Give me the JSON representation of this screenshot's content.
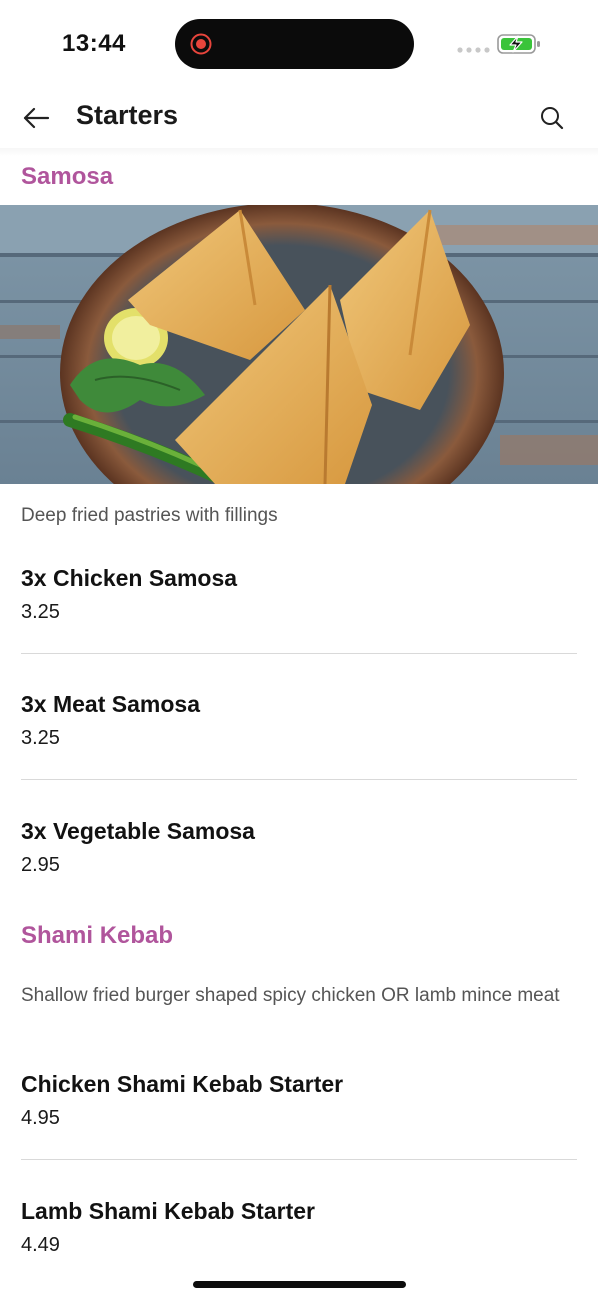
{
  "status_bar": {
    "time": "13:44",
    "icons": [
      "screen-record-icon",
      "signal-dots-icon",
      "battery-charging-icon"
    ]
  },
  "header": {
    "title": "Starters",
    "back_icon": "arrow-left-icon",
    "search_icon": "search-icon"
  },
  "colors": {
    "accent": "#b0559c",
    "battery_green": "#3ac43a",
    "record_red": "#e8453c"
  },
  "sections": [
    {
      "heading": "Samosa",
      "image": "samosa-photo",
      "description": "Deep fried pastries with fillings",
      "items": [
        {
          "name": "3x Chicken Samosa",
          "price": "3.25"
        },
        {
          "name": "3x Meat Samosa",
          "price": "3.25"
        },
        {
          "name": "3x Vegetable Samosa",
          "price": "2.95"
        }
      ]
    },
    {
      "heading": "Shami Kebab",
      "description": "Shallow fried burger shaped spicy chicken OR lamb mince meat",
      "items": [
        {
          "name": "Chicken Shami Kebab Starter",
          "price": "4.95"
        },
        {
          "name": "Lamb Shami Kebab Starter",
          "price": "4.49"
        }
      ]
    }
  ]
}
